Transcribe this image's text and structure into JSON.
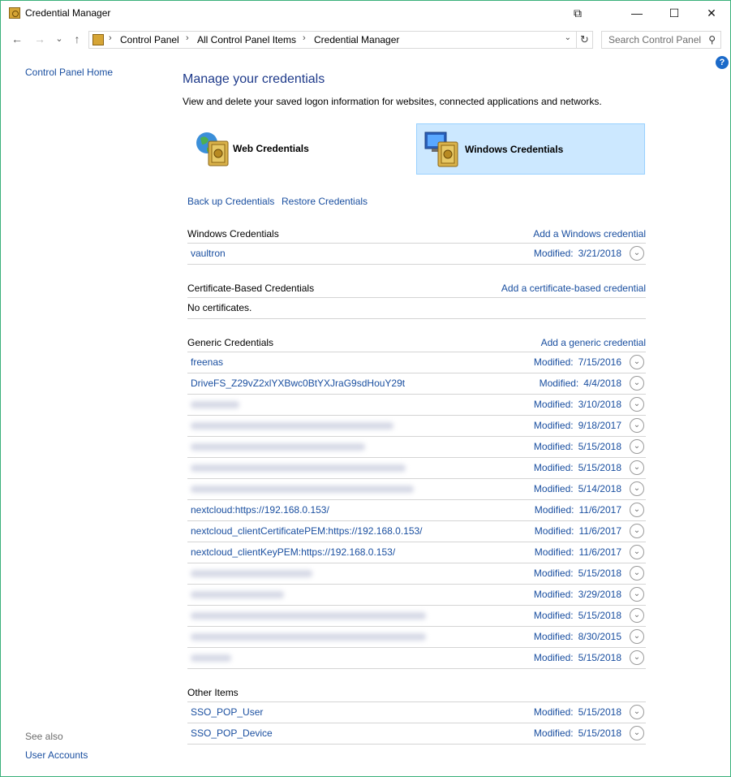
{
  "window": {
    "title": "Credential Manager"
  },
  "titlebar": {
    "min_glyph": "—",
    "max_glyph": "☐",
    "close_glyph": "✕",
    "extra_glyph": "⧉"
  },
  "nav": {
    "back_glyph": "←",
    "forward_glyph": "→",
    "recent_glyph": "⌄",
    "up_glyph": "↑",
    "breadcrumb": [
      "Control Panel",
      "All Control Panel Items",
      "Credential Manager"
    ],
    "sep": "›",
    "refresh_glyph": "↻",
    "dropdown_glyph": "⌄",
    "search_placeholder": "Search Control Panel",
    "search_glyph": "⚲"
  },
  "help_glyph": "?",
  "sidebar": {
    "home": "Control Panel Home",
    "see_also": "See also",
    "user_accounts": "User Accounts"
  },
  "main": {
    "heading": "Manage your credentials",
    "intro": "View and delete your saved logon information for websites, connected applications and networks.",
    "tiles": {
      "web": "Web Credentials",
      "windows": "Windows Credentials"
    },
    "backup": "Back up Credentials",
    "restore": "Restore Credentials",
    "modified_label": "Modified:",
    "chevron_glyph": "⌄"
  },
  "sections": {
    "windows": {
      "title": "Windows Credentials",
      "add": "Add a Windows credential",
      "rows": [
        {
          "name": "vaultron",
          "date": "3/21/2018"
        }
      ]
    },
    "certificate": {
      "title": "Certificate-Based Credentials",
      "add": "Add a certificate-based credential",
      "empty": "No certificates."
    },
    "generic": {
      "title": "Generic Credentials",
      "add": "Add a generic credential",
      "rows": [
        {
          "name": "freenas",
          "date": "7/15/2016"
        },
        {
          "name": "DriveFS_Z29vZ2xlYXBwc0BtYXJraG9sdHouY29t",
          "date": "4/4/2018"
        },
        {
          "name": "",
          "date": "3/10/2018"
        },
        {
          "name": "",
          "date": "9/18/2017"
        },
        {
          "name": "",
          "date": "5/15/2018"
        },
        {
          "name": "",
          "date": "5/15/2018"
        },
        {
          "name": "",
          "date": "5/14/2018"
        },
        {
          "name": "nextcloud:https://192.168.0.153/",
          "date": "11/6/2017"
        },
        {
          "name": "nextcloud_clientCertificatePEM:https://192.168.0.153/",
          "date": "11/6/2017"
        },
        {
          "name": "nextcloud_clientKeyPEM:https://192.168.0.153/",
          "date": "11/6/2017"
        },
        {
          "name": "",
          "date": "5/15/2018"
        },
        {
          "name": "",
          "date": "3/29/2018"
        },
        {
          "name": "",
          "date": "5/15/2018"
        },
        {
          "name": "",
          "date": "8/30/2015"
        },
        {
          "name": "",
          "date": "5/15/2018"
        }
      ]
    },
    "other": {
      "title": "Other Items",
      "rows": [
        {
          "name": "SSO_POP_User",
          "date": "5/15/2018"
        },
        {
          "name": "SSO_POP_Device",
          "date": "5/15/2018"
        }
      ]
    }
  }
}
